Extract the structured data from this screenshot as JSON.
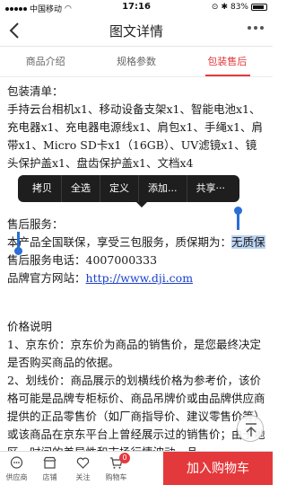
{
  "status": {
    "carrier": "中国移动",
    "time": "17:16",
    "battery": "83%"
  },
  "nav": {
    "title": "图文详情"
  },
  "tabs": [
    {
      "label": "商品介绍"
    },
    {
      "label": "规格参数"
    },
    {
      "label": "包装售后"
    }
  ],
  "content": {
    "pack_title": "包装清单：",
    "pack_body": "手持云台相机x1、移动设备支架x1、智能电池x1、充电器x1、充电器电源线x1、肩包x1、手绳x1、肩带x1、Micro SD卡x1（16GB）、UV滤镜x1、镜头保护盖x1、盘齿保护盖x1、文档x4",
    "after_title": "售后服务：",
    "after_body": "本产品全国联保，享受三包服务，质保期为：",
    "after_selected": "无质保",
    "phone_label": "售后服务电话：",
    "phone": "4007000333",
    "site_label": "品牌官方网站：",
    "site_url": "http://www.dji.com",
    "price_title": "价格说明",
    "price_1": "1、京东价：京东价为商品的销售价，是您最终决定是否购买商品的依据。",
    "price_2": "2、划线价：商品展示的划横线价格为参考价，该价格可能是品牌专柜标价、商品吊牌价或由品牌供应商提供的正品零售价（如厂商指导价、建议零售价等）或该商品在京东平台上曾经展示过的销售价；由于地区、时间的差异性和市场行情波动，品"
  },
  "context_menu": {
    "copy": "拷贝",
    "select_all": "全选",
    "define": "定义",
    "add": "添加...",
    "share": "共享···"
  },
  "bottom": {
    "shop_label": "供应商",
    "store_label": "店铺",
    "follow_label": "关注",
    "cart_label": "购物车",
    "cart_count": "0",
    "add_to_cart": "加入购物车"
  },
  "colors": {
    "accent": "#e4393c",
    "selection": "#bcd4f2",
    "link": "#1a3fcc"
  }
}
